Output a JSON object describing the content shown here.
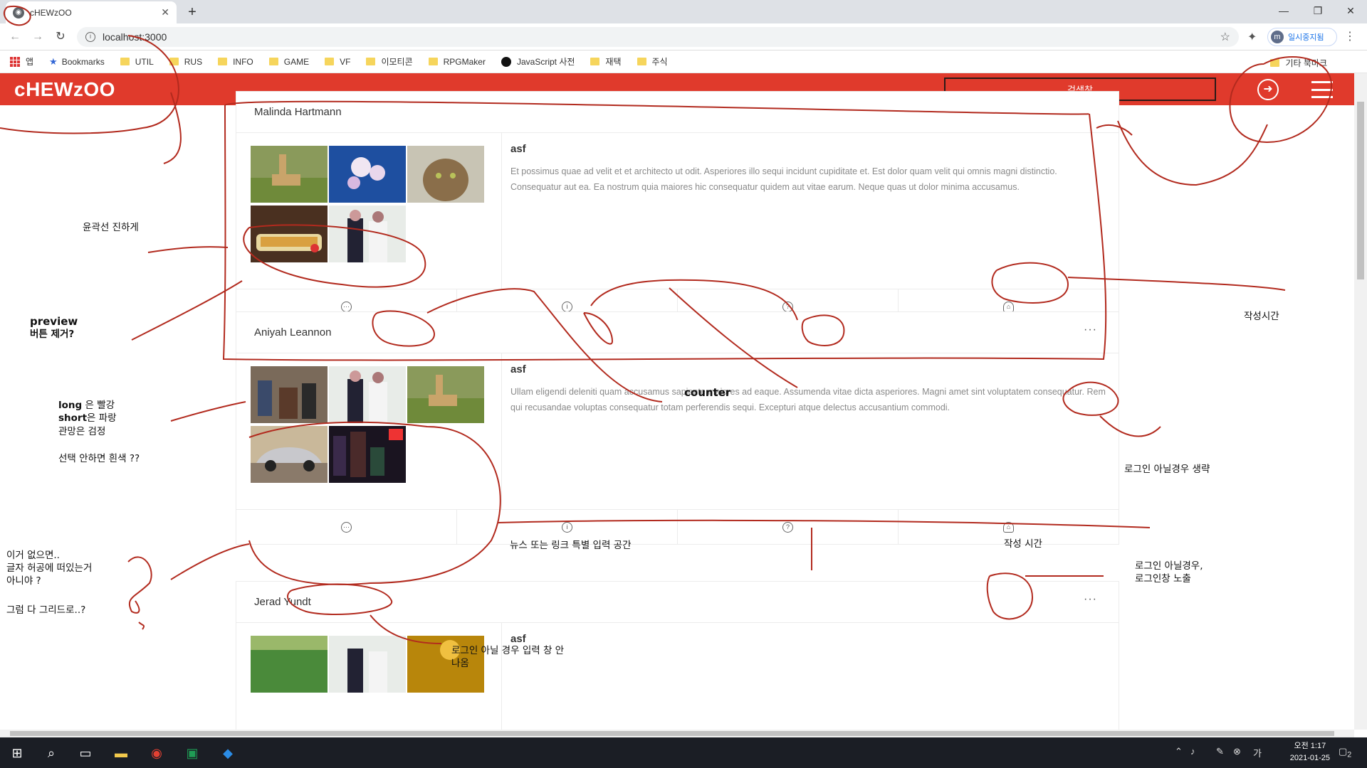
{
  "browser": {
    "tab_title": "cHEWzOO",
    "url": "localhost:3000",
    "profile_label": "일시중지됨",
    "profile_initial": "m",
    "bookmarks": [
      {
        "icon": "apps-icon",
        "label": "앱"
      },
      {
        "icon": "star-icon",
        "label": "Bookmarks"
      },
      {
        "icon": "folder-icon",
        "label": "UTIL"
      },
      {
        "icon": "folder-icon",
        "label": "RUS"
      },
      {
        "icon": "folder-icon",
        "label": "INFO"
      },
      {
        "icon": "folder-icon",
        "label": "GAME"
      },
      {
        "icon": "folder-icon",
        "label": "VF"
      },
      {
        "icon": "folder-icon",
        "label": "이모티콘"
      },
      {
        "icon": "folder-icon",
        "label": "RPGMaker"
      },
      {
        "icon": "dot-icon",
        "label": "JavaScript 사전"
      },
      {
        "icon": "folder-icon",
        "label": "재택"
      },
      {
        "icon": "folder-icon",
        "label": "주식"
      }
    ],
    "other_bookmarks": "기타 북마크"
  },
  "app": {
    "logo": "cHEWzOO",
    "search_label": "검색창",
    "brand_color": "#e03a2c"
  },
  "posts": [
    {
      "author": "Malinda Hartmann",
      "title": "asf",
      "description": "Et possimus quae ad velit et et architecto ut odit. Asperiores illo sequi incidunt cupiditate et. Est dolor quam velit qui omnis magni distinctio. Consequatur aut ea. Ea nostrum quia maiores hic consequatur quidem aut vitae earum. Neque quas ut dolor minima accusamus.",
      "images": [
        "giraffe",
        "orchid",
        "cat",
        "food",
        "people"
      ]
    },
    {
      "author": "Aniyah Leannon",
      "title": "asf",
      "description": "Ullam eligendi deleniti quam accusamus sapiente maiores ad eaque. Assumenda vitae dicta asperiores. Magni amet sint voluptatem consequatur. Rem qui recusandae voluptas consequatur totam perferendis sequi. Excepturi atque delectus accusantium commodi.",
      "images": [
        "street",
        "people",
        "giraffe",
        "car",
        "city-night"
      ]
    },
    {
      "author": "Jerad Yundt",
      "title": "asf",
      "images": [
        "crowd",
        "people",
        "golden"
      ]
    }
  ],
  "notes": {
    "outline": "윤곽선 진하게",
    "preview_1": "preview",
    "preview_2": "버튼 제거?",
    "counter": "counter",
    "written_time_right": "작성시간",
    "long_1": "long",
    "long_2": " 은 빨강",
    "short_1": "short",
    "short_2": "은 파랑",
    "watch": "관망은 검정",
    "unselected": "선택 안하면 흰색 ??",
    "omit_if_not_login": "로그인 아닐경우 생략",
    "news_link": "뉴스 또는 링크 특별 입력 공간",
    "written_time": "작성 시간",
    "login_popup": "로그인 아닐경우,\n로그인창 노출",
    "floating": "이거 없으면..\n글자 허공에 떠있는거\n아니야 ?",
    "grid_all": "그럼 다 그리드로..?",
    "no_input_if_not_login": "로그인 아닐 경우 입력 창 안\n나옴"
  },
  "taskbar": {
    "clock_time": "오전 1:17",
    "clock_date": "2021-01-25",
    "notification_count": "2"
  }
}
